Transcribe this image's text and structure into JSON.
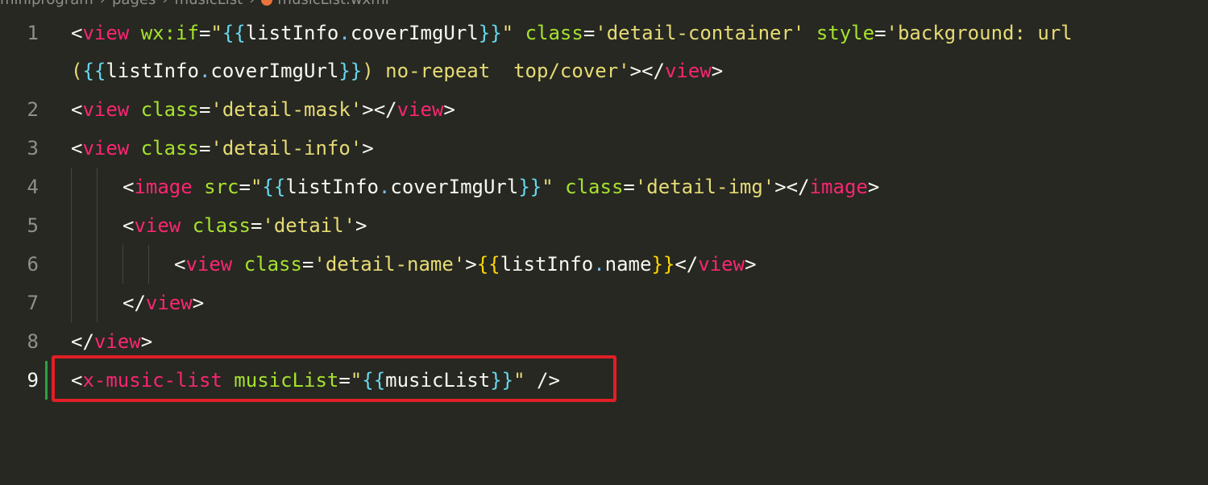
{
  "breadcrumb": {
    "parts": [
      "miniprogram",
      "pages",
      "musicList",
      "musicList.wxml"
    ]
  },
  "gutter": [
    "1",
    "2",
    "3",
    "4",
    "5",
    "6",
    "7",
    "8",
    "9"
  ],
  "code": {
    "l1": {
      "t1": "<",
      "t2": "view",
      "t3": " ",
      "t4": "wx:if",
      "t5": "=",
      "t6": "\"",
      "t7": "{{",
      "t8": "listInfo",
      "t9": ".",
      "t10": "coverImgUrl",
      "t11": "}}",
      "t12": "\"",
      "t13": " ",
      "t14": "class",
      "t15": "=",
      "t16": "'detail-container'",
      "t17": " ",
      "t18": "style",
      "t19": "=",
      "t20": "'background: url"
    },
    "l1b": {
      "t1": "(",
      "t2": "{{",
      "t3": "listInfo",
      "t4": ".",
      "t5": "coverImgUrl",
      "t6": "}}",
      "t7": ") no-repeat  top/cover'",
      "t8": "></",
      "t9": "view",
      "t10": ">"
    },
    "l2": {
      "t1": "<",
      "t2": "view",
      "t3": " ",
      "t4": "class",
      "t5": "=",
      "t6": "'detail-mask'",
      "t7": "></",
      "t8": "view",
      "t9": ">"
    },
    "l3": {
      "t1": "<",
      "t2": "view",
      "t3": " ",
      "t4": "class",
      "t5": "=",
      "t6": "'detail-info'",
      "t7": ">"
    },
    "l4": {
      "t1": "<",
      "t2": "image",
      "t3": " ",
      "t4": "src",
      "t5": "=",
      "t6": "\"",
      "t7": "{{",
      "t8": "listInfo",
      "t9": ".",
      "t10": "coverImgUrl",
      "t11": "}}",
      "t12": "\"",
      "t13": " ",
      "t14": "class",
      "t15": "=",
      "t16": "'detail-img'",
      "t17": "></",
      "t18": "image",
      "t19": ">"
    },
    "l5": {
      "t1": "<",
      "t2": "view",
      "t3": " ",
      "t4": "class",
      "t5": "=",
      "t6": "'detail'",
      "t7": ">"
    },
    "l6": {
      "t1": "<",
      "t2": "view",
      "t3": " ",
      "t4": "class",
      "t5": "=",
      "t6": "'detail-name'",
      "t7": ">",
      "t8": "{{",
      "t9": "listInfo",
      "t10": ".",
      "t11": "name",
      "t12": "}}",
      "t13": "</",
      "t14": "view",
      "t15": ">"
    },
    "l7": {
      "t1": "</",
      "t2": "view",
      "t3": ">"
    },
    "l8": {
      "t1": "</",
      "t2": "view",
      "t3": ">"
    },
    "l9": {
      "t1": "<",
      "t2": "x-music-list",
      "t3": " ",
      "t4": "musicList",
      "t5": "=",
      "t6": "\"",
      "t7": "{{",
      "t8": "musicList",
      "t9": "}}",
      "t10": "\"",
      "t11": " />"
    }
  },
  "colors": {
    "background": "#272822",
    "tag": "#F92672",
    "attribute": "#A6E22E",
    "string": "#E6DB74",
    "brace": "#66D9EF",
    "highlight_box": "#E01F26",
    "modified_bar": "#2EA043"
  }
}
